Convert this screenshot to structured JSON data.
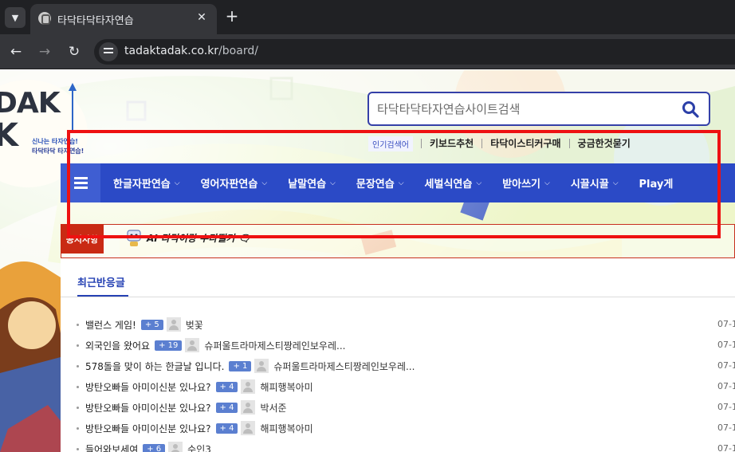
{
  "browser": {
    "tab_title": "타닥타닥타자연습",
    "url_host": "tadaktadak.co.kr",
    "url_path": "/board/"
  },
  "logo": {
    "line1": "DAK",
    "line2": "K",
    "tagline1": "신나는 타자연습!",
    "tagline2": "타닥타닥 타자연습!"
  },
  "search": {
    "placeholder": "타닥타닥타자연습사이트검색"
  },
  "popular": {
    "label": "인기검색어",
    "items": [
      "키보드추천",
      "타닥이스티커구매",
      "궁금한것묻기"
    ]
  },
  "menu": {
    "items": [
      "한글자판연습",
      "영어자판연습",
      "낱말연습",
      "문장연습",
      "세벌식연습",
      "받아쓰기",
      "시끌시끌",
      "Play게"
    ]
  },
  "notice": {
    "badge": "공지사항",
    "text": "AI 타닥이랑 수다떨기 🗨"
  },
  "content": {
    "tab": "최근반응글",
    "posts": [
      {
        "title": "밸런스 게임!",
        "comments": "+ 5",
        "user": "벚꽃",
        "date": "07-1"
      },
      {
        "title": "외국인을 왔어요",
        "comments": "+ 19",
        "user": "슈퍼울트라마제스티짱레인보우레...",
        "date": "07-1"
      },
      {
        "title": "578돌을 맞이 하는 한글날 입니다.",
        "comments": "+ 1",
        "user": "슈퍼울트라마제스티짱레인보우레...",
        "date": "07-1"
      },
      {
        "title": "방탄오빠들 아미이신분 있나요?",
        "comments": "+ 4",
        "user": "해피행복아미",
        "date": "07-1"
      },
      {
        "title": "방탄오빠들 아미이신분 있나요?",
        "comments": "+ 4",
        "user": "박서준",
        "date": "07-1"
      },
      {
        "title": "방탄오빠들 아미이신분 있나요?",
        "comments": "+ 4",
        "user": "해피행복아미",
        "date": "07-1"
      },
      {
        "title": "들어와보세여",
        "comments": "+ 6",
        "user": "수인3",
        "date": "07-1"
      }
    ]
  },
  "colors": {
    "menu_bg": "#2b4ac6",
    "accent_blue": "#2642b4",
    "notice_red": "#c92a14",
    "annotation_red": "#ee1111"
  }
}
